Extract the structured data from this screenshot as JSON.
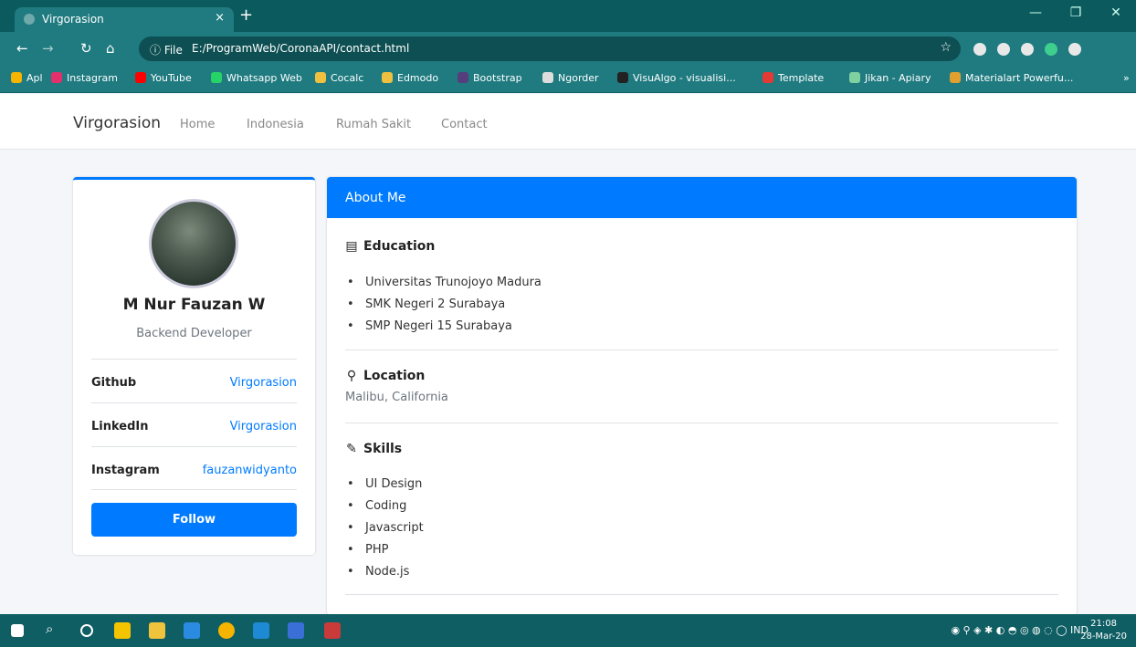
{
  "browser": {
    "tab_title": "Virgorasion",
    "tab_close": "×",
    "new_tab": "+",
    "info_label": "ⓘ File",
    "url": "E:/ProgramWeb/CoronaAPI/contact.html"
  },
  "bookmarks": [
    {
      "label": "Apl",
      "icon_color": "#f4b400"
    },
    {
      "label": "Instagram",
      "icon_color": "#e1306c"
    },
    {
      "label": "YouTube",
      "icon_color": "#ff0000"
    },
    {
      "label": "Whatsapp Web",
      "icon_color": "#25d366"
    },
    {
      "label": "Cocalc",
      "icon_color": "#f0c040"
    },
    {
      "label": "Edmodo",
      "icon_color": "#f0c040"
    },
    {
      "label": "Bootstrap",
      "icon_color": "#563d7c"
    },
    {
      "label": "Ngorder",
      "icon_color": "#dddddd"
    },
    {
      "label": "VisuAlgo - visualisi...",
      "icon_color": "#222222"
    },
    {
      "label": "Template",
      "icon_color": "#e53935"
    },
    {
      "label": "Jikan - Apiary",
      "icon_color": "#7fd1a0"
    },
    {
      "label": "Materialart Powerfu...",
      "icon_color": "#e0a030"
    }
  ],
  "navbar": {
    "brand": "Virgorasion",
    "links": [
      "Home",
      "Indonesia",
      "Rumah Sakit",
      "Contact"
    ]
  },
  "profile": {
    "name": "M Nur Fauzan W",
    "role": "Backend Developer",
    "rows": [
      {
        "key": "Github",
        "value": "Virgorasion"
      },
      {
        "key": "LinkedIn",
        "value": "Virgorasion"
      },
      {
        "key": "Instagram",
        "value": "fauzanwidyanto"
      }
    ],
    "follow_label": "Follow"
  },
  "about": {
    "header": "About Me",
    "education_title": "Education",
    "education": [
      "Universitas Trunojoyo Madura",
      "SMK Negeri 2 Surabaya",
      "SMP Negeri 15 Surabaya"
    ],
    "location_title": "Location",
    "location": "Malibu, California",
    "skills_title": "Skills",
    "skills": [
      "UI Design",
      "Coding",
      "Javascript",
      "PHP",
      "Node.js"
    ]
  },
  "taskbar": {
    "lang": "IND",
    "time": "21:08",
    "date": "28-Mar-20"
  },
  "colors": {
    "accent": "#007bff",
    "chrome": "#1f7b80"
  }
}
